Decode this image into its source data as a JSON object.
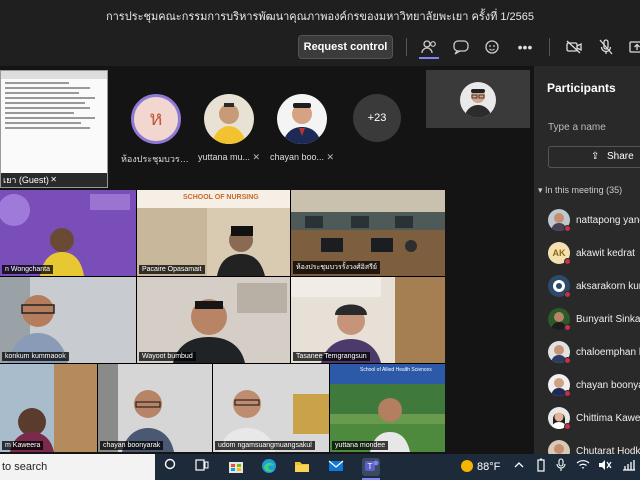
{
  "window": {
    "title": "การประชุมคณะกรรมการบริหารพัฒนาคุณภาพองค์กรของมหาวิทยาลัยพะเยา ครั้งที่ 1/2565"
  },
  "toolbar": {
    "request_control_label": "Request control",
    "icons": [
      "people-icon",
      "chat-icon",
      "reactions-icon",
      "more-icon",
      "camera-off-icon",
      "mic-off-icon",
      "share-icon"
    ],
    "more_glyph": "•••"
  },
  "stage": {
    "shared_doc_label": "เยา (Guest)",
    "top_participants": [
      {
        "initial": "ห",
        "name": "ห้องประชุมบวรรั..."
      },
      {
        "name": "yuttana mu..."
      },
      {
        "name": "chayan boo..."
      }
    ],
    "overflow_count": "+23"
  },
  "grid": {
    "tiles": [
      {
        "label": "n Wongchanta"
      },
      {
        "label": "Pacaire Opasamait",
        "header": "SCHOOL OF NURSING"
      },
      {
        "label": "ห้องประชุมบวรรั้งวงศ์อิสรีย์"
      },
      {
        "label": "konkum kummaook"
      },
      {
        "label": "Wayoot bumbud"
      },
      {
        "label": "Tasanee Temgrangsun"
      },
      {
        "label": "m Kaweera"
      },
      {
        "label": "chayan boonyarak"
      },
      {
        "label": "udom ngamsuangmuangsakul"
      },
      {
        "label": "yuttana mondee",
        "header": "School of Allied Health Sciences"
      }
    ]
  },
  "participants_panel": {
    "title": "Participants",
    "search_placeholder": "Type a name",
    "share_label": "Share",
    "in_meeting_label": "In this meeting (35)",
    "people": [
      {
        "name": "nattapong yang"
      },
      {
        "name": "akawit kedrat",
        "initials": "AK"
      },
      {
        "name": "aksarakorn kum"
      },
      {
        "name": "Bunyarit Sinkan"
      },
      {
        "name": "chaloemphan ka"
      },
      {
        "name": "chayan boonyar"
      },
      {
        "name": "Chittima Kawee"
      },
      {
        "name": "Chutarat Hodka"
      }
    ]
  },
  "taskbar": {
    "search_text": "to search",
    "weather_temp": "88°F",
    "icons": [
      "search-icon",
      "task-view-icon",
      "store-icon",
      "edge-icon",
      "file-explorer-icon",
      "mail-icon",
      "teams-icon",
      "chevron-up-icon",
      "battery-icon",
      "volume-icon",
      "wifi-icon"
    ]
  },
  "colors": {
    "accent": "#6264a7",
    "muted_red": "#c4314b",
    "tile_purple": "#8a5cc7"
  }
}
